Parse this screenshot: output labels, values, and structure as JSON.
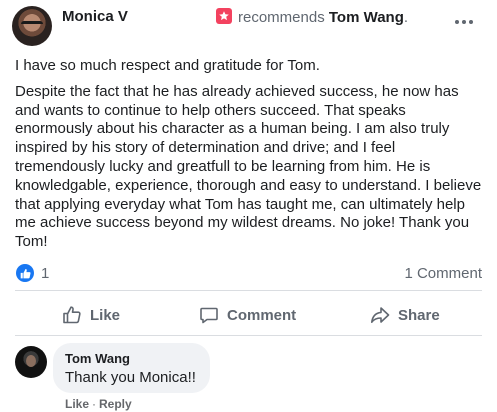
{
  "post": {
    "author": "Monica V",
    "recommends_text": "recommends",
    "recommended_page": "Tom Wang",
    "recommended_suffix": ".",
    "paragraphs": [
      "I have so much respect and gratitude for Tom.",
      "Despite the fact that he has already achieved success, he now has and wants to continue to help others succeed. That speaks enormously about his character as a human being. I am also truly inspired by his story of determination and drive; and I feel tremendously lucky and greatfull to be learning from him. He is knowledgable, experience, thorough and easy to understand. I believe that applying everyday what Tom has taught me, can ultimately help me achieve success beyond my wildest dreams. No joke!  Thank you Tom!"
    ]
  },
  "reactions": {
    "like_count": "1",
    "comment_count": "1 Comment"
  },
  "actions": {
    "like": "Like",
    "comment": "Comment",
    "share": "Share"
  },
  "comment": {
    "author": "Tom Wang",
    "text": "Thank you Monica!!",
    "like_label": "Like",
    "separator": "·",
    "reply_label": "Reply"
  },
  "colors": {
    "recommend_accent": "#f3425f",
    "like_blue": "#1877f2",
    "muted_text": "#606770",
    "bubble_bg": "#f0f2f5"
  },
  "icons": [
    "star-recommend-icon",
    "more-options-icon",
    "like-reaction-icon",
    "thumbs-up-icon",
    "comment-icon",
    "share-icon"
  ]
}
